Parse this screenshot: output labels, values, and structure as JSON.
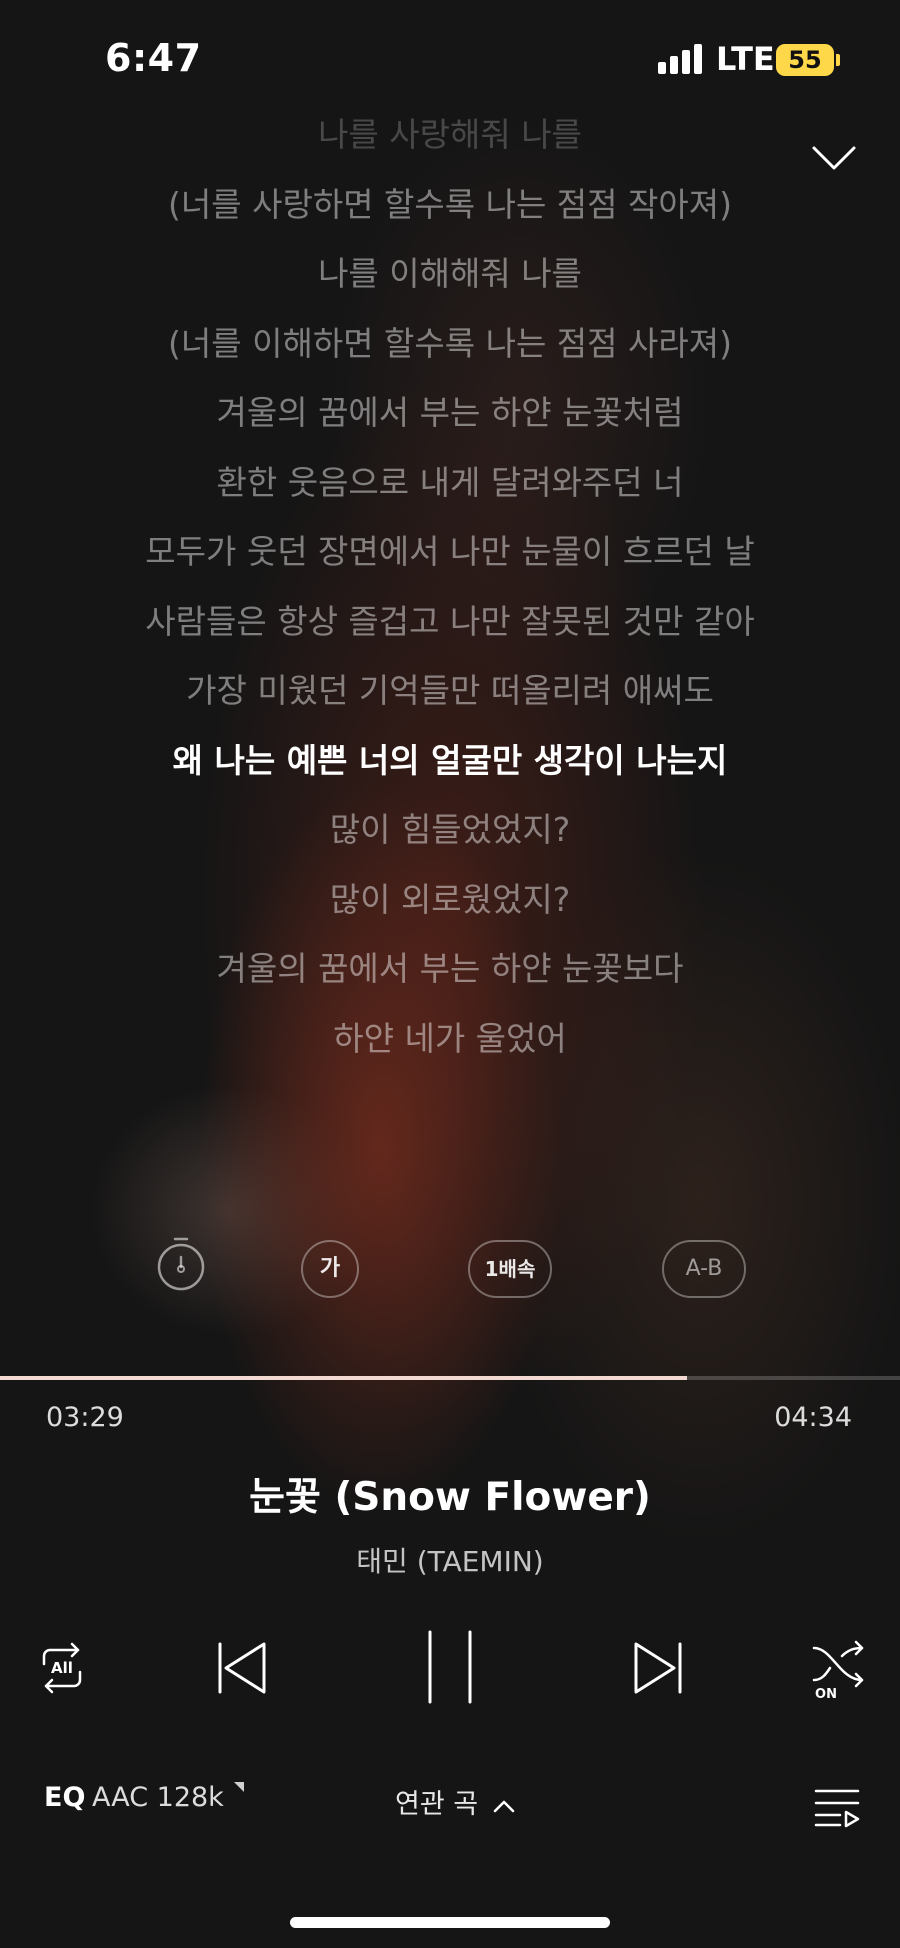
{
  "status_bar": {
    "time": "6:47",
    "network": "LTE",
    "battery": "55"
  },
  "lyrics": [
    "나를 사랑해줘 나를",
    "(너를 사랑하면 할수록 나는 점점 작아져)",
    "나를 이해해줘 나를",
    "(너를 이해하면 할수록 나는 점점 사라져)",
    "겨울의 꿈에서 부는 하얀 눈꽃처럼",
    "환한 웃음으로 내게 달려와주던 너",
    "모두가 웃던 장면에서 나만 눈물이 흐르던 날",
    "사람들은 항상 즐겁고 나만 잘못된 것만 같아",
    "가장 미웠던 기억들만 떠올리려 애써도",
    "왜 나는 예쁜 너의 얼굴만 생각이 나는지",
    "많이 힘들었었지?",
    "많이 외로웠었지?",
    "겨울의 꿈에서 부는 하얀 눈꽃보다",
    "하얀 네가 울었어"
  ],
  "active_lyric_index": 9,
  "lyric_options": {
    "font_size_label": "가",
    "speed_label": "1배속",
    "ab_label": "A-B"
  },
  "playback": {
    "elapsed": "03:29",
    "total": "04:34",
    "progress": 0.763
  },
  "track": {
    "title": "눈꽃 (Snow Flower)",
    "artist": "태민 (TAEMIN)"
  },
  "controls": {
    "repeat_label": "All",
    "shuffle_label": "ON"
  },
  "footer": {
    "eq_label": "EQ",
    "codec": "AAC 128k",
    "related_label": "연관 곡"
  }
}
